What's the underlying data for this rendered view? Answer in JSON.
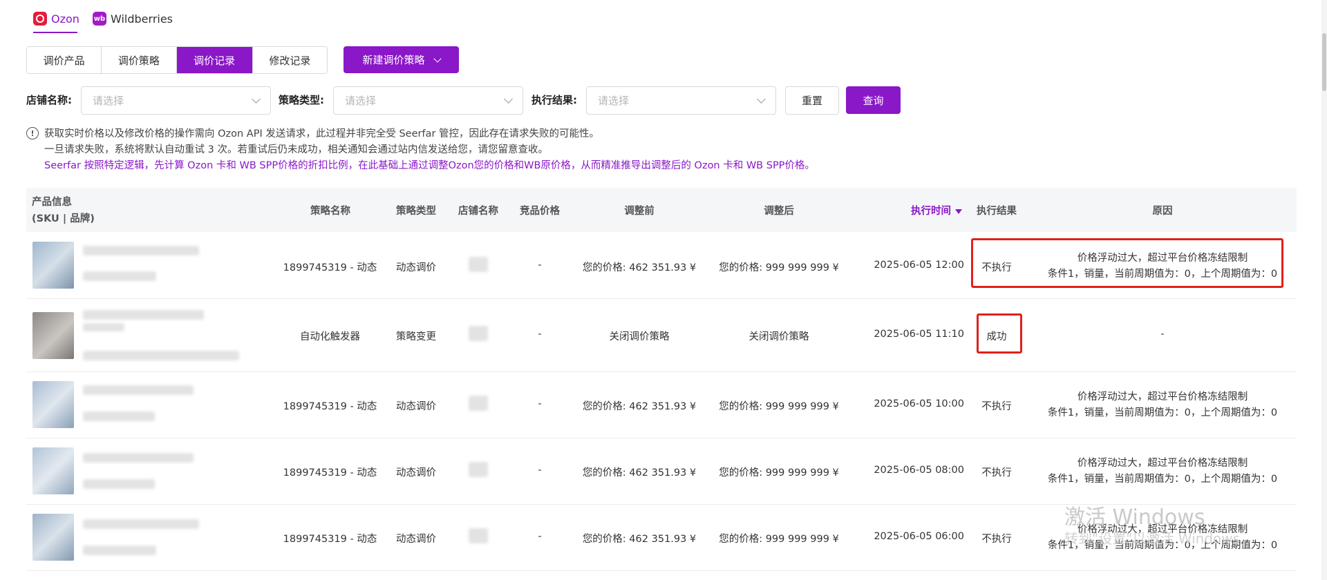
{
  "platform_tabs": [
    {
      "label": "Ozon",
      "logo_color": "#e51b3c",
      "active": true
    },
    {
      "label": "Wildberries",
      "logo_text": "wb",
      "logo_color": "#a21bc6",
      "active": false
    }
  ],
  "sub_tabs": [
    "调价产品",
    "调价策略",
    "调价记录",
    "修改记录"
  ],
  "active_sub_tab": "调价记录",
  "new_strategy_button": "新建调价策略",
  "filters": {
    "shop_label": "店铺名称:",
    "shop_placeholder": "请选择",
    "strategy_type_label": "策略类型:",
    "strategy_type_placeholder": "请选择",
    "result_label": "执行结果:",
    "result_placeholder": "请选择",
    "reset": "重置",
    "query": "查询"
  },
  "notice": {
    "line1": "获取实时价格以及修改价格的操作需向 Ozon API 发送请求，此过程并非完全受 Seerfar 管控，因此存在请求失败的可能性。",
    "line2": "一旦请求失败，系统将默认自动重试 3 次。若重试后仍未成功，相关通知会通过站内信发送给您，请您留意查收。",
    "line3": "Seerfar 按照特定逻辑，先计算 Ozon 卡和 WB SPP价格的折扣比例，在此基础上通过调整Ozon您的价格和WB原价格，从而精准推导出调整后的 Ozon 卡和 WB SPP价格。"
  },
  "table": {
    "headers": {
      "product_line1": "产品信息",
      "product_line2": "(SKU | 品牌)",
      "strategy_name": "策略名称",
      "strategy_type": "策略类型",
      "shop_name": "店铺名称",
      "competitor_price": "竞品价格",
      "before": "调整前",
      "after": "调整后",
      "exec_time": "执行时间",
      "exec_result": "执行结果",
      "reason": "原因"
    },
    "rows": [
      {
        "strategy_name": "1899745319 - 动态",
        "strategy_type": "动态调价",
        "competitor_price": "-",
        "before": "您的价格: 462 351.93 ¥",
        "after": "您的价格: 999 999 999 ¥",
        "exec_time": "2025-06-05 12:00",
        "exec_result": "不执行",
        "reason_line1": "价格浮动过大，超过平台价格冻结限制",
        "reason_line2": "条件1，销量，当前周期值为：0，上个周期值为：0"
      },
      {
        "strategy_name": "自动化触发器",
        "strategy_type": "策略变更",
        "competitor_price": "-",
        "before": "关闭调价策略",
        "after": "关闭调价策略",
        "exec_time": "2025-06-05 11:10",
        "exec_result": "成功",
        "reason_line1": "-",
        "reason_line2": ""
      },
      {
        "strategy_name": "1899745319 - 动态",
        "strategy_type": "动态调价",
        "competitor_price": "-",
        "before": "您的价格: 462 351.93 ¥",
        "after": "您的价格: 999 999 999 ¥",
        "exec_time": "2025-06-05 10:00",
        "exec_result": "不执行",
        "reason_line1": "价格浮动过大，超过平台价格冻结限制",
        "reason_line2": "条件1，销量，当前周期值为：0，上个周期值为：0"
      },
      {
        "strategy_name": "1899745319 - 动态",
        "strategy_type": "动态调价",
        "competitor_price": "-",
        "before": "您的价格: 462 351.93 ¥",
        "after": "您的价格: 999 999 999 ¥",
        "exec_time": "2025-06-05 08:00",
        "exec_result": "不执行",
        "reason_line1": "价格浮动过大，超过平台价格冻结限制",
        "reason_line2": "条件1，销量，当前周期值为：0，上个周期值为：0"
      },
      {
        "strategy_name": "1899745319 - 动态",
        "strategy_type": "动态调价",
        "competitor_price": "-",
        "before": "您的价格: 462 351.93 ¥",
        "after": "您的价格: 999 999 999 ¥",
        "exec_time": "2025-06-05 06:00",
        "exec_result": "不执行",
        "reason_line1": "价格浮动过大，超过平台价格冻结限制",
        "reason_line2": "条件1，销量，当前周期值为：0，上个周期值为：0"
      }
    ]
  },
  "watermark": {
    "line1": "激活 Windows",
    "line2": "转到\"设置\"以激活 Windows。"
  },
  "colors": {
    "accent": "#8a17c8",
    "highlight_box": "#e0201c"
  }
}
